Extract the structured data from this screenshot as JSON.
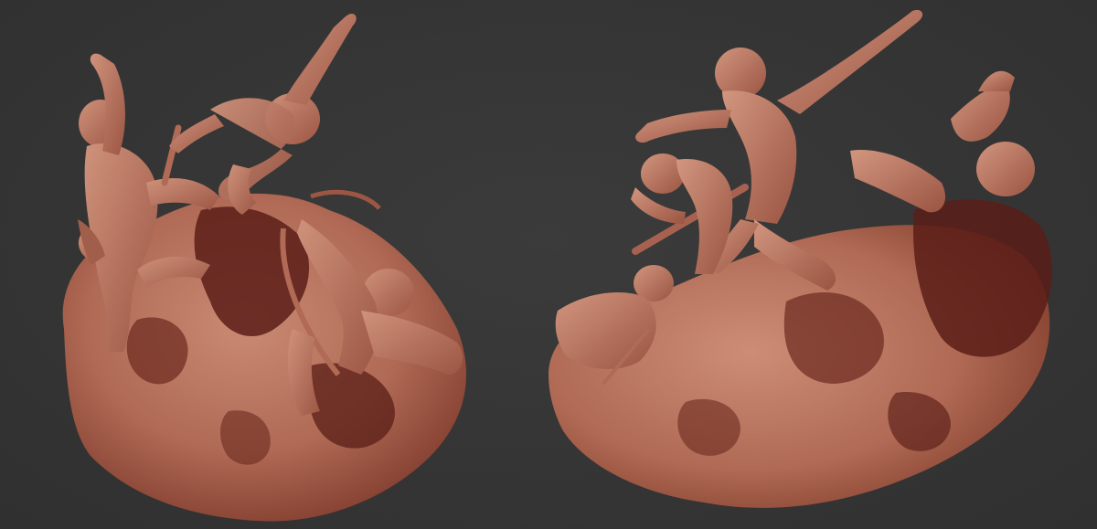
{
  "scene": {
    "background_color": "#353535",
    "clay_color": "#b06a55",
    "clay_highlight": "#c98a73",
    "clay_shadow": "#5a1d17",
    "views": [
      {
        "name": "sculpture-view-left",
        "subject": "figures-fighting-on-rock"
      },
      {
        "name": "sculpture-view-right",
        "subject": "figures-fighting-on-rock"
      }
    ]
  }
}
